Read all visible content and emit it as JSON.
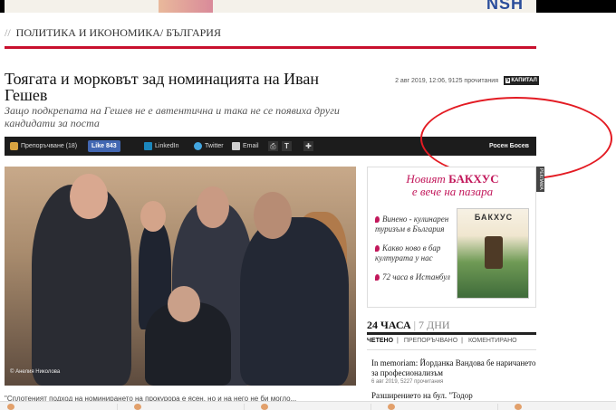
{
  "banner": {
    "brand": "NSH"
  },
  "breadcrumb": {
    "separator": "//",
    "items": [
      "ПОЛИТИКА И ИКОНОМИКА",
      "БЪЛГАРИЯ"
    ],
    "divider": "/"
  },
  "article": {
    "title": "Тоягата и морковът зад номинацията на Иван Гешев",
    "subtitle": "Защо подкрепата на Гешев не е автентична и така не се появиха други кандидати за поста",
    "meta": "2 авг 2019, 12:06, 9125 прочитания",
    "badge_number": "5",
    "badge_label": "КАПИТАЛ",
    "photo_credit": "© Анелия Николова",
    "body_preview": "\"Сплотеният подход на номинирането на прокурора е ясен, но и на него не би могло..."
  },
  "share_bar": {
    "recommend_label": "Препоръчване (18)",
    "like_label": "Like 843",
    "linkedin_label": "LinkedIn",
    "twitter_label": "Twitter",
    "email_label": "Email",
    "print_icon": "print-icon",
    "text_size_label": "T",
    "comment_icon": "comment-plus-icon",
    "author": "Росен Босев"
  },
  "ad": {
    "headline_prefix": "Новият ",
    "headline_brand": "БАКХУС",
    "headline_suffix": "е вече на пазара",
    "bullets": [
      "Винено - кулинарен туризъм в България",
      "Какво ново в бар културата у нас",
      "72 часа в Истанбул"
    ],
    "magazine_title": "БАКХУС",
    "side_label": "РЕКЛАМА",
    "accent_color": "#c2185b"
  },
  "sidebar": {
    "tab_active": "24 ЧАСА",
    "tab_inactive": "7 ДНИ",
    "subtabs": [
      "ЧЕТЕНО",
      "ПРЕПОРЪЧВАНО",
      "КОМЕНТИРАНО"
    ],
    "news": [
      {
        "title": "In memoriam: Йорданка Вандова бе наричането за професионализъм",
        "meta": "6 авг 2019, 5227 прочитания"
      },
      {
        "title": "Разширението на бул. \"Тодор",
        "meta": ""
      }
    ]
  },
  "colors": {
    "brand_red": "#c8102e",
    "annotation_red": "#e31b23",
    "share_bar_bg": "#1c1c1c"
  }
}
